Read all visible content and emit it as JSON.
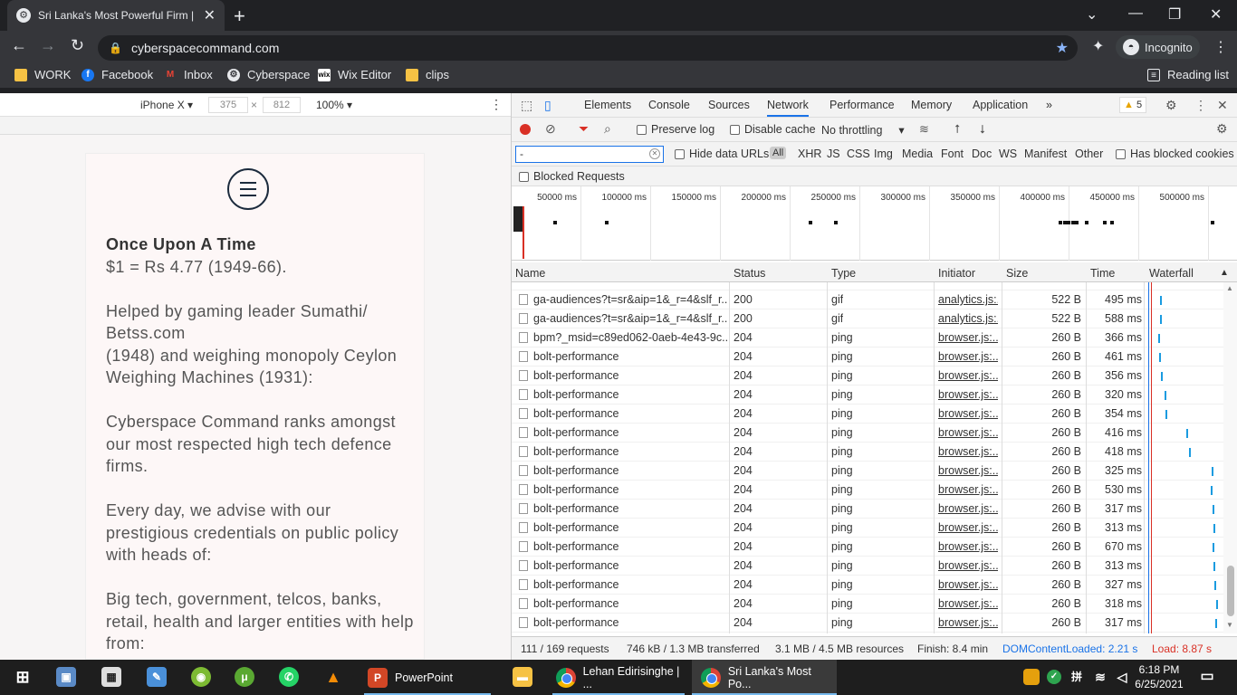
{
  "browser": {
    "tab_title": "Sri Lanka's Most Powerful Firm | C",
    "url": "cyberspacecommand.com",
    "incognito_label": "Incognito",
    "bookmarks": [
      "WORK",
      "Facebook",
      "Inbox",
      "Cyberspace",
      "Wix Editor",
      "clips"
    ],
    "reading_list": "Reading list"
  },
  "device_toolbar": {
    "device": "iPhone X ▾",
    "width": "375",
    "times": "×",
    "height": "812",
    "zoom": "100% ▾"
  },
  "page": {
    "heading": "Once Upon A Time",
    "p1": "$1 = Rs 4.77 (1949-66).",
    "p2a": "Helped by gaming leader Sumathi/ Betss.com",
    "p2b": "(1948) and weighing monopoly Ceylon Weighing Machines (1931):",
    "p3": "Cyberspace Command ranks amongst our most respected high tech defence firms.",
    "p4": "Every day, we advise with our prestigious credentials on public policy with heads of:",
    "p5": "Big tech, government, telcos, banks, retail, health and larger entities with help from:"
  },
  "devtools": {
    "tabs": [
      "Elements",
      "Console",
      "Sources",
      "Network",
      "Performance",
      "Memory",
      "Application"
    ],
    "more": "»",
    "active_tab": "Network",
    "warnings": "5",
    "preserve_log": "Preserve log",
    "disable_cache": "Disable cache",
    "throttling": "No throttling",
    "filter_value": "-",
    "hide_data_urls": "Hide data URLs",
    "types": [
      "All",
      "XHR",
      "JS",
      "CSS",
      "Img",
      "Media",
      "Font",
      "Doc",
      "WS",
      "Manifest",
      "Other"
    ],
    "has_blocked_cookies": "Has blocked cookies",
    "blocked_requests": "Blocked Requests",
    "overview_labels": [
      "50000 ms",
      "100000 ms",
      "150000 ms",
      "200000 ms",
      "250000 ms",
      "300000 ms",
      "350000 ms",
      "400000 ms",
      "450000 ms",
      "500000 ms",
      "5"
    ],
    "columns": [
      "Name",
      "Status",
      "Type",
      "Initiator",
      "Size",
      "Time",
      "Waterfall"
    ],
    "rows": [
      {
        "name": "ga-audiences?t=sr&aip=1&_r=4&slf_r...",
        "status": "200",
        "type": "gif",
        "initiator": "analytics.js:...",
        "size": "522 B",
        "time": "495 ms"
      },
      {
        "name": "ga-audiences?t=sr&aip=1&_r=4&slf_r...",
        "status": "200",
        "type": "gif",
        "initiator": "analytics.js:...",
        "size": "522 B",
        "time": "588 ms"
      },
      {
        "name": "bpm?_msid=c89ed062-0aeb-4e43-9c...",
        "status": "204",
        "type": "ping",
        "initiator": "browser.js:...",
        "size": "260 B",
        "time": "366 ms"
      },
      {
        "name": "bolt-performance",
        "status": "204",
        "type": "ping",
        "initiator": "browser.js:...",
        "size": "260 B",
        "time": "461 ms"
      },
      {
        "name": "bolt-performance",
        "status": "204",
        "type": "ping",
        "initiator": "browser.js:...",
        "size": "260 B",
        "time": "356 ms"
      },
      {
        "name": "bolt-performance",
        "status": "204",
        "type": "ping",
        "initiator": "browser.js:...",
        "size": "260 B",
        "time": "320 ms"
      },
      {
        "name": "bolt-performance",
        "status": "204",
        "type": "ping",
        "initiator": "browser.js:...",
        "size": "260 B",
        "time": "354 ms"
      },
      {
        "name": "bolt-performance",
        "status": "204",
        "type": "ping",
        "initiator": "browser.js:...",
        "size": "260 B",
        "time": "416 ms"
      },
      {
        "name": "bolt-performance",
        "status": "204",
        "type": "ping",
        "initiator": "browser.js:...",
        "size": "260 B",
        "time": "418 ms"
      },
      {
        "name": "bolt-performance",
        "status": "204",
        "type": "ping",
        "initiator": "browser.js:...",
        "size": "260 B",
        "time": "325 ms"
      },
      {
        "name": "bolt-performance",
        "status": "204",
        "type": "ping",
        "initiator": "browser.js:...",
        "size": "260 B",
        "time": "530 ms"
      },
      {
        "name": "bolt-performance",
        "status": "204",
        "type": "ping",
        "initiator": "browser.js:...",
        "size": "260 B",
        "time": "317 ms"
      },
      {
        "name": "bolt-performance",
        "status": "204",
        "type": "ping",
        "initiator": "browser.js:...",
        "size": "260 B",
        "time": "313 ms"
      },
      {
        "name": "bolt-performance",
        "status": "204",
        "type": "ping",
        "initiator": "browser.js:...",
        "size": "260 B",
        "time": "670 ms"
      },
      {
        "name": "bolt-performance",
        "status": "204",
        "type": "ping",
        "initiator": "browser.js:...",
        "size": "260 B",
        "time": "313 ms"
      },
      {
        "name": "bolt-performance",
        "status": "204",
        "type": "ping",
        "initiator": "browser.js:...",
        "size": "260 B",
        "time": "327 ms"
      },
      {
        "name": "bolt-performance",
        "status": "204",
        "type": "ping",
        "initiator": "browser.js:...",
        "size": "260 B",
        "time": "318 ms"
      },
      {
        "name": "bolt-performance",
        "status": "204",
        "type": "ping",
        "initiator": "browser.js:...",
        "size": "260 B",
        "time": "317 ms"
      }
    ],
    "status": {
      "requests": "111 / 169 requests",
      "transferred": "746 kB / 1.3 MB transferred",
      "resources": "3.1 MB / 4.5 MB resources",
      "finish": "Finish: 8.4 min",
      "dcl": "DOMContentLoaded: 2.21 s",
      "load": "Load: 8.87 s"
    }
  },
  "taskbar": {
    "powerpoint": "PowerPoint",
    "chrome1": "Lehan Edirisinghe | ...",
    "chrome2": "Sri Lanka's Most Po...",
    "time": "6:18 PM",
    "date": "6/25/2021"
  },
  "colors": {
    "accent": "#1a73e8",
    "record": "#d93025",
    "dcl": "#1a73e8",
    "load": "#d93025"
  }
}
